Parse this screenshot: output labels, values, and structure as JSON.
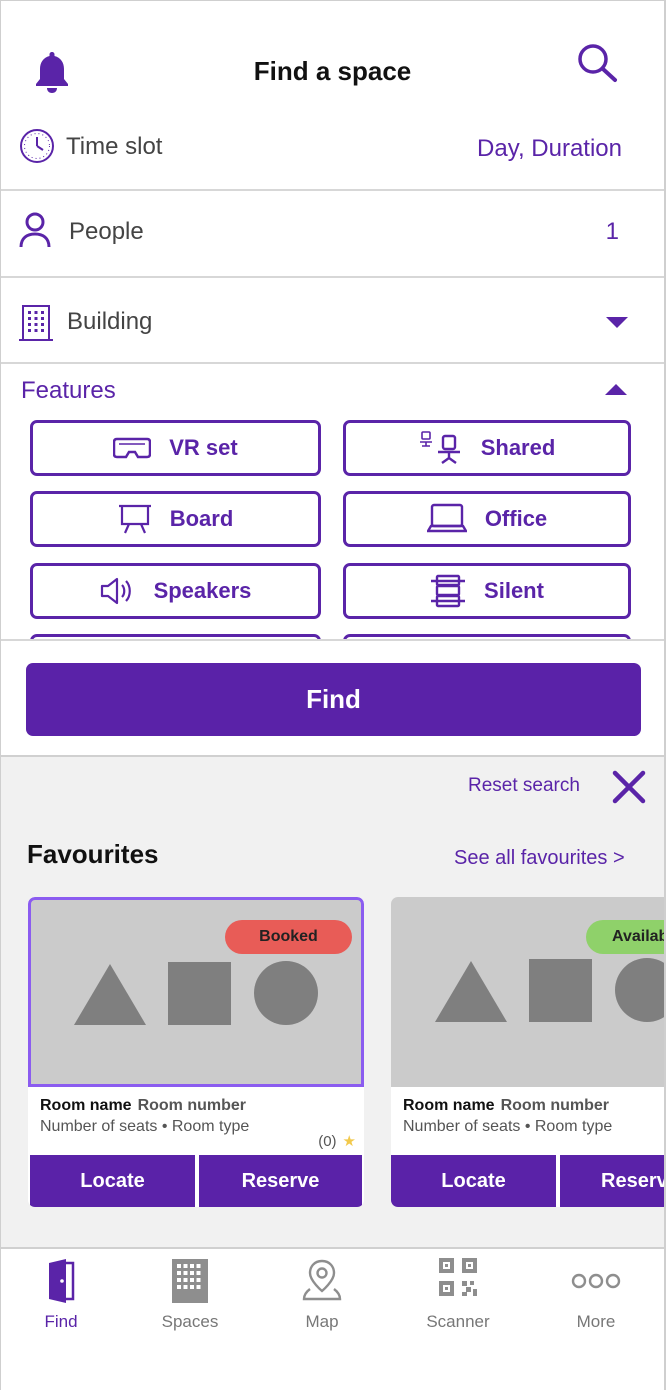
{
  "header": {
    "title": "Find a space",
    "icons": [
      "bell-icon",
      "search-icon"
    ]
  },
  "filters": {
    "time_slot": {
      "label": "Time slot",
      "value": "Day, Duration"
    },
    "people": {
      "label": "People",
      "value": "1"
    },
    "building": {
      "label": "Building"
    },
    "features": {
      "title": "Features",
      "items": [
        {
          "label": "VR set",
          "icon": "vr-headset-icon"
        },
        {
          "label": "Shared",
          "icon": "shared-desk-icon"
        },
        {
          "label": "Board",
          "icon": "board-icon"
        },
        {
          "label": "Office",
          "icon": "laptop-icon"
        },
        {
          "label": "Speakers",
          "icon": "speaker-icon"
        },
        {
          "label": "Silent",
          "icon": "silent-icon"
        }
      ]
    }
  },
  "find_button": "Find",
  "search_actions": {
    "reset_label": "Reset search"
  },
  "favourites": {
    "title": "Favourites",
    "see_all": "See all favourites >",
    "cards": [
      {
        "status": "Booked",
        "status_color": "#e85c57",
        "room_name": "Room name",
        "room_number": "Room number",
        "meta": "Number of seats • Room type",
        "rating": "(0)",
        "locate": "Locate",
        "reserve": "Reserve"
      },
      {
        "status": "Available",
        "status_color": "#8fd16a",
        "room_name": "Room name",
        "room_number": "Room number",
        "meta": "Number of seats • Room type",
        "locate": "Locate",
        "reserve": "Reserve"
      }
    ]
  },
  "tabbar": {
    "items": [
      {
        "label": "Find",
        "active": true
      },
      {
        "label": "Spaces"
      },
      {
        "label": "Map"
      },
      {
        "label": "Scanner"
      },
      {
        "label": "More"
      }
    ]
  },
  "colors": {
    "primary": "#5a22a8",
    "accent_text": "#5a24a8",
    "booked": "#e85c57",
    "available": "#8fd16a",
    "background_grey": "#f1f1f1"
  }
}
